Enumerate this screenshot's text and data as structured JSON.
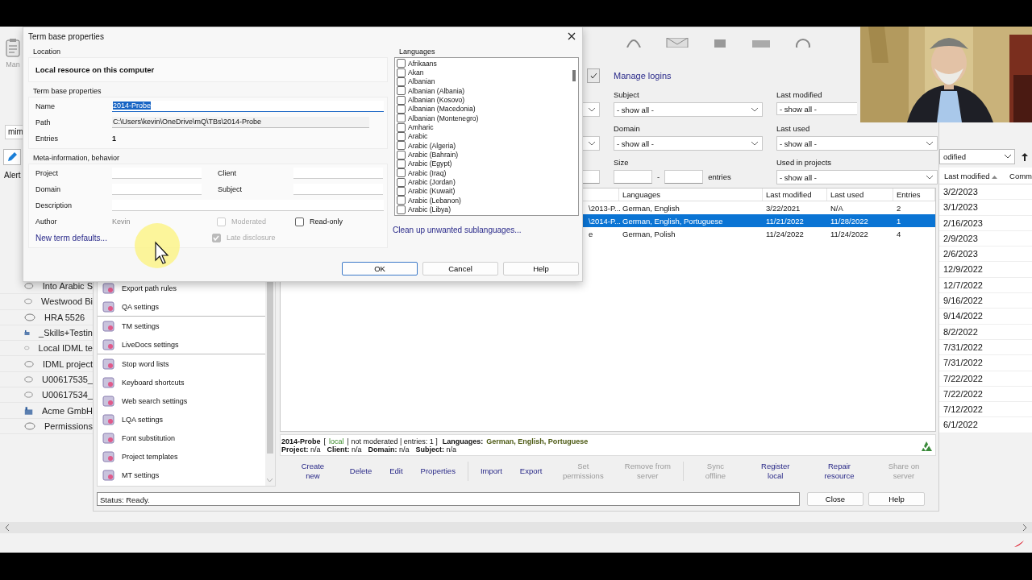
{
  "main_window": {
    "toolbar_label": "Man",
    "search_value": "mim",
    "alert_label": "Alert",
    "projects": [
      {
        "name": "Into Arabic S",
        "kind": "cloud"
      },
      {
        "name": "Westwood Bi",
        "kind": "cloud"
      },
      {
        "name": "HRA 5526",
        "kind": "cloud"
      },
      {
        "name": "_Skills+Testin",
        "kind": "briefcase"
      },
      {
        "name": "Local IDML te",
        "kind": "cloud"
      },
      {
        "name": "IDML project",
        "kind": "cloud"
      },
      {
        "name": "U00617535_",
        "kind": "cloud"
      },
      {
        "name": "U00617534_",
        "kind": "cloud"
      },
      {
        "name": "Acme GmbH",
        "kind": "briefcase"
      },
      {
        "name": "Permissions",
        "kind": "cloud"
      }
    ],
    "sort_dropdown": "odified",
    "date_column": {
      "header": "Last modified",
      "partial_header": "Comm",
      "dates": [
        "3/2/2023",
        "3/1/2023",
        "2/16/2023",
        "2/9/2023",
        "2/6/2023",
        "12/9/2022",
        "12/7/2022",
        "9/16/2022",
        "9/14/2022",
        "8/2/2022",
        "7/31/2022",
        "7/31/2022",
        "7/22/2022",
        "7/22/2022",
        "7/12/2022",
        "6/1/2022"
      ]
    }
  },
  "resource_console": {
    "logins_checkbox": {
      "checked": true
    },
    "manage_logins": "Manage logins",
    "filters": [
      {
        "label": "Subject",
        "value": "- show all -"
      },
      {
        "label": "Last modified",
        "value": "- show all -"
      },
      {
        "label": "Domain",
        "value": "- show all -"
      },
      {
        "label": "Last used",
        "value": "- show all -"
      }
    ],
    "size": {
      "label": "Size",
      "separator": "-",
      "unit": "entries"
    },
    "used_in_projects": {
      "label": "Used in projects",
      "value": "- show all -"
    },
    "table": {
      "columns": [
        "Languages",
        "Last modified",
        "Last used",
        "Entries"
      ],
      "rows": [
        {
          "column_1": "\\2013-P...",
          "languages": "German, English",
          "last_modified": "3/22/2021",
          "last_used": "N/A",
          "entries": "2",
          "selected": false
        },
        {
          "column_1": "\\2014-P...",
          "languages": "German, English, Portuguese",
          "last_modified": "11/21/2022",
          "last_used": "11/28/2022",
          "entries": "1",
          "selected": true
        },
        {
          "column_1": "e",
          "languages": "German, Polish",
          "last_modified": "11/24/2022",
          "last_used": "11/24/2022",
          "entries": "4",
          "selected": false
        }
      ]
    },
    "settings_list": [
      {
        "label": "Export path rules",
        "separator_after": false
      },
      {
        "label": "QA settings",
        "separator_after": true
      },
      {
        "label": "TM settings",
        "separator_after": false
      },
      {
        "label": "LiveDocs settings",
        "separator_after": true
      },
      {
        "label": "Stop word lists",
        "separator_after": false
      },
      {
        "label": "Keyboard shortcuts",
        "separator_after": false
      },
      {
        "label": "Web search settings",
        "separator_after": false
      },
      {
        "label": "LQA settings",
        "separator_after": false
      },
      {
        "label": "Font substitution",
        "separator_after": false
      },
      {
        "label": "Project templates",
        "separator_after": false
      },
      {
        "label": "MT settings",
        "separator_after": false
      }
    ],
    "info": {
      "line_1": [
        {
          "text": "2014-Probe",
          "kind": "name"
        },
        {
          "text": "[",
          "kind": "plain"
        },
        {
          "text": "local",
          "kind": "green"
        },
        {
          "text": "| not moderated | entries: 1 ]",
          "kind": "plain"
        },
        {
          "text": "Languages:",
          "kind": "label"
        },
        {
          "text": "German, English, Portuguese",
          "kind": "value"
        }
      ],
      "line_2": [
        {
          "label": "Project:",
          "value": "n/a"
        },
        {
          "label": "Client:",
          "value": "n/a"
        },
        {
          "label": "Domain:",
          "value": "n/a"
        },
        {
          "label": "Subject:",
          "value": "n/a"
        }
      ]
    },
    "action_groups": [
      [
        {
          "label": "Create new",
          "disabled": false
        },
        {
          "label": "Delete",
          "disabled": false
        },
        {
          "label": "Edit",
          "disabled": false
        },
        {
          "label": "Properties",
          "disabled": false
        }
      ],
      [
        {
          "label": "Import",
          "disabled": false
        },
        {
          "label": "Export",
          "disabled": false
        },
        {
          "label": "Set permissions",
          "disabled": true
        },
        {
          "label": "Remove from server",
          "disabled": true
        }
      ],
      [
        {
          "label": "Sync offline",
          "disabled": true
        },
        {
          "label": "Register local",
          "disabled": false
        },
        {
          "label": "Repair resource",
          "disabled": false
        },
        {
          "label": "Share on server",
          "disabled": true
        }
      ]
    ],
    "status": "Status: Ready.",
    "buttons": [
      "Close",
      "Help"
    ]
  },
  "dialog": {
    "title": "Term base properties",
    "location": {
      "legend": "Location",
      "text": "Local resource on this computer"
    },
    "properties": {
      "legend": "Term base properties",
      "name": {
        "label": "Name",
        "value": "2014-Probe",
        "text_selected": true
      },
      "path": {
        "label": "Path",
        "value": "C:\\Users\\kevin\\OneDrive\\mQ\\TBs\\2014-Probe"
      },
      "entries": {
        "label": "Entries",
        "value": "1"
      }
    },
    "meta": {
      "legend": "Meta-information, behavior",
      "pairs": [
        [
          "Project",
          "Client"
        ],
        [
          "Domain",
          "Subject"
        ]
      ],
      "description": "Description",
      "author": {
        "label": "Author",
        "value": "Kevin"
      },
      "moderated": {
        "label": "Moderated",
        "checked": false,
        "disabled": true
      },
      "read_only": {
        "label": "Read-only",
        "checked": false,
        "disabled": false
      },
      "late_disclosure": {
        "label": "Late disclosure",
        "checked": true,
        "disabled": true
      }
    },
    "new_term_defaults": "New term defaults...",
    "languages": {
      "label": "Languages",
      "items": [
        {
          "name": "Afrikaans",
          "checked": false
        },
        {
          "name": "Akan",
          "checked": false
        },
        {
          "name": "Albanian",
          "checked": false
        },
        {
          "name": "Albanian (Albania)",
          "checked": false
        },
        {
          "name": "Albanian (Kosovo)",
          "checked": false
        },
        {
          "name": "Albanian (Macedonia)",
          "checked": false
        },
        {
          "name": "Albanian (Montenegro)",
          "checked": false
        },
        {
          "name": "Amharic",
          "checked": false
        },
        {
          "name": "Arabic",
          "checked": false
        },
        {
          "name": "Arabic (Algeria)",
          "checked": false
        },
        {
          "name": "Arabic (Bahrain)",
          "checked": false
        },
        {
          "name": "Arabic (Egypt)",
          "checked": false
        },
        {
          "name": "Arabic (Iraq)",
          "checked": false
        },
        {
          "name": "Arabic (Jordan)",
          "checked": false
        },
        {
          "name": "Arabic (Kuwait)",
          "checked": false
        },
        {
          "name": "Arabic (Lebanon)",
          "checked": false
        },
        {
          "name": "Arabic (Libya)",
          "checked": false
        }
      ]
    },
    "cleanup_link": "Clean up unwanted sublanguages...",
    "buttons": [
      {
        "label": "OK",
        "default": true
      },
      {
        "label": "Cancel",
        "default": false
      },
      {
        "label": "Help",
        "default": false
      }
    ]
  }
}
